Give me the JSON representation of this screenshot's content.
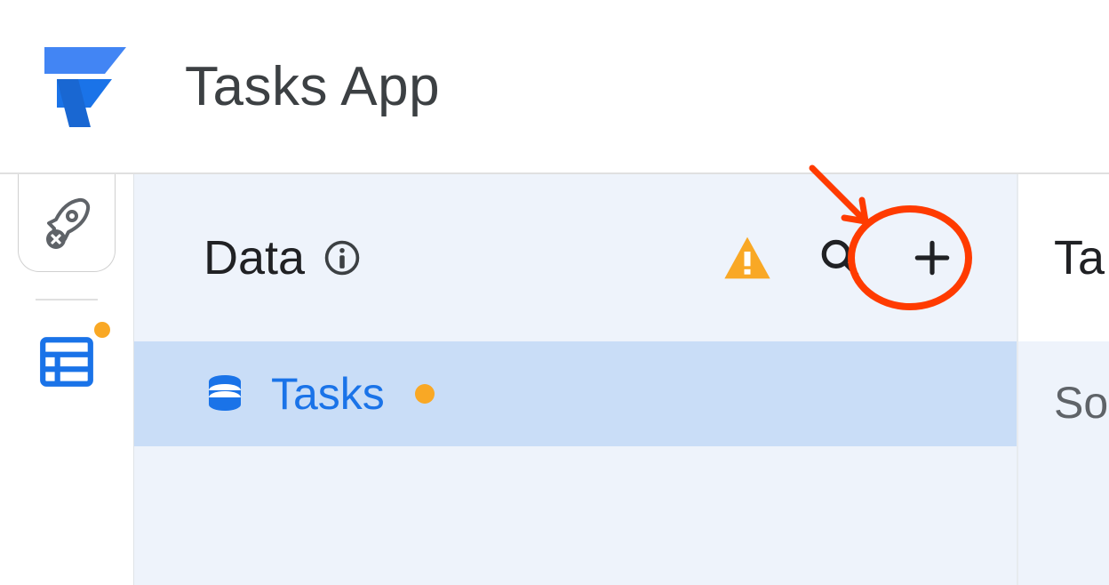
{
  "app": {
    "title": "Tasks App"
  },
  "dataPanel": {
    "heading": "Data",
    "tables": [
      {
        "name": "Tasks",
        "status": "needs-attention"
      }
    ]
  },
  "rightPanel": {
    "titleVisible": "Ta",
    "subtitleVisible": "So"
  },
  "icons": {
    "logo": "appsheet-logo",
    "rocket": "rocket-icon",
    "data": "database-icon",
    "info": "info-icon",
    "warning": "warning-icon",
    "search": "search-icon",
    "add": "plus-icon",
    "tableSource": "database-icon"
  },
  "colors": {
    "accent": "#1a73e8",
    "warning": "#f9a825",
    "annotation": "#ff3b00",
    "panelBg": "#eef3fb",
    "selectedRow": "#c9ddf7"
  },
  "annotation": {
    "target": "add-table-button",
    "shape": "circle-with-arrow"
  }
}
